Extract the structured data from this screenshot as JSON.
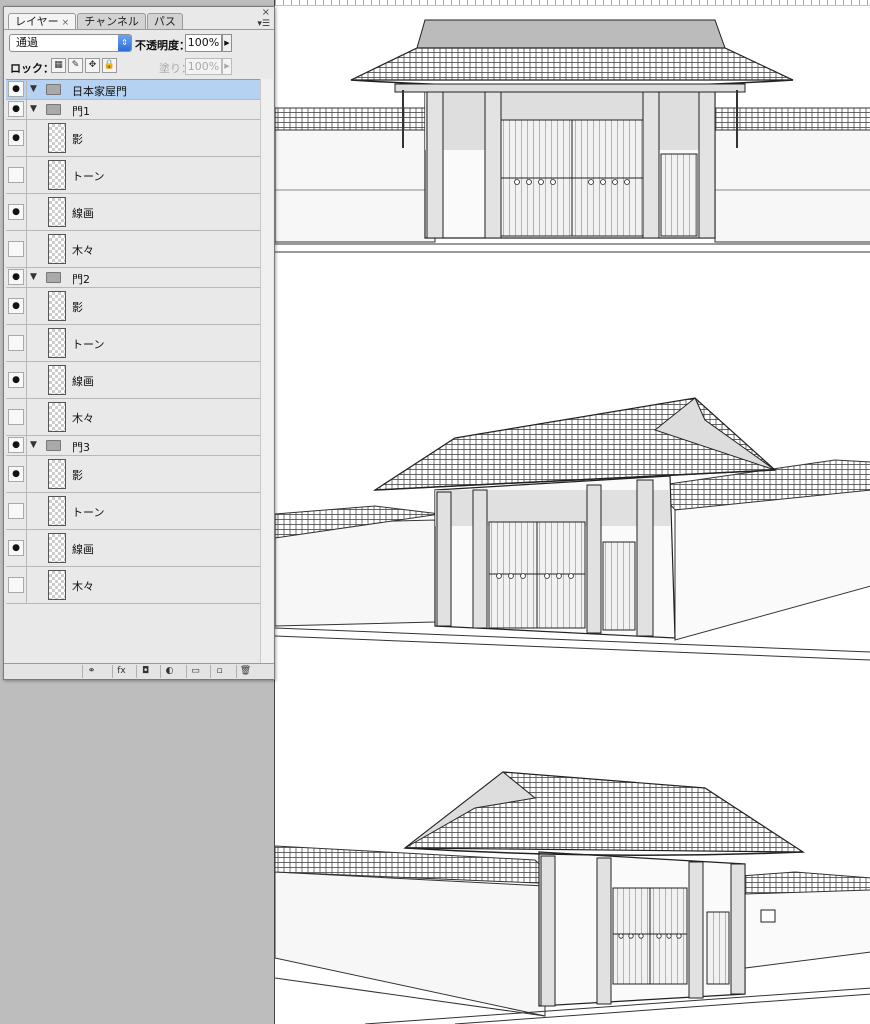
{
  "panel": {
    "tabs": [
      {
        "label": "レイヤー",
        "active": true
      },
      {
        "label": "チャンネル",
        "active": false
      },
      {
        "label": "パス",
        "active": false
      }
    ],
    "close_glyph": "×",
    "menu_glyph": "▾☰",
    "blend_mode": "通過",
    "opacity_label": "不透明度：",
    "opacity_value": "100%",
    "lock_label": "ロック：",
    "fill_label": "塗り：",
    "fill_value": "100%"
  },
  "layers": [
    {
      "type": "group",
      "name": "日本家屋門",
      "visible": true,
      "selected": true,
      "depth": 0
    },
    {
      "type": "group",
      "name": "門1",
      "visible": true,
      "depth": 1
    },
    {
      "type": "layer",
      "name": "影",
      "visible": true
    },
    {
      "type": "layer",
      "name": "トーン",
      "visible": false
    },
    {
      "type": "layer",
      "name": "線画",
      "visible": true
    },
    {
      "type": "layer",
      "name": "木々",
      "visible": false
    },
    {
      "type": "group",
      "name": "門2",
      "visible": true,
      "depth": 1
    },
    {
      "type": "layer",
      "name": "影",
      "visible": true
    },
    {
      "type": "layer",
      "name": "トーン",
      "visible": false
    },
    {
      "type": "layer",
      "name": "線画",
      "visible": true
    },
    {
      "type": "layer",
      "name": "木々",
      "visible": false
    },
    {
      "type": "group",
      "name": "門3",
      "visible": true,
      "depth": 1
    },
    {
      "type": "layer",
      "name": "影",
      "visible": true
    },
    {
      "type": "layer",
      "name": "トーン",
      "visible": false
    },
    {
      "type": "layer",
      "name": "線画",
      "visible": true
    },
    {
      "type": "layer",
      "name": "木々",
      "visible": false
    }
  ],
  "footer_icons": [
    "link-layers-icon",
    "fx-icon",
    "add-mask-icon",
    "adjustment-layer-icon",
    "new-group-icon",
    "new-layer-icon",
    "trash-icon"
  ],
  "footer_glyphs": [
    "⚭",
    "fx",
    "◘",
    "◐",
    "▭",
    "▫",
    "🗑"
  ],
  "colors": {
    "selection": "#b5d2f3",
    "workspace": "#bdbdbd",
    "canvas": "#ffffff"
  }
}
